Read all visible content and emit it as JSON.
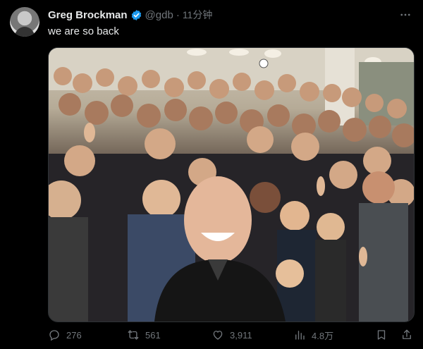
{
  "author": {
    "name": "Greg Brockman",
    "handle": "@gdb",
    "separator": "·",
    "time": "11分钟"
  },
  "tweet": {
    "text": "we are so back"
  },
  "actions": {
    "replies": "276",
    "retweets": "561",
    "likes": "3,911",
    "views": "4.8万"
  },
  "colors": {
    "background": "#000000",
    "text": "#e7e9ea",
    "muted": "#71767b",
    "verified": "#1d9bf0"
  },
  "icons": {
    "more": "more-icon",
    "verified": "verified-badge-icon",
    "reply": "reply-icon",
    "retweet": "retweet-icon",
    "like": "heart-icon",
    "views": "views-icon",
    "bookmark": "bookmark-icon",
    "share": "share-icon"
  }
}
